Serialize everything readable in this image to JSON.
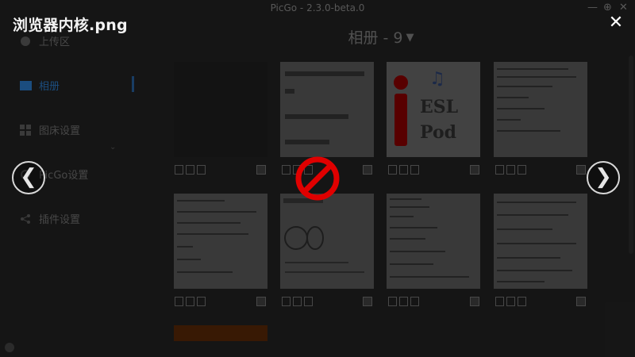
{
  "app": {
    "title": "PicGo - 2.3.0-beta.0",
    "window_controls": [
      "minimize-icon",
      "settings-icon",
      "close-icon"
    ]
  },
  "sidebar": {
    "items": [
      {
        "label": "上传区",
        "icon": "upload-icon"
      },
      {
        "label": "相册",
        "icon": "image-icon",
        "active": true
      },
      {
        "label": "图床设置",
        "icon": "grid-icon"
      },
      {
        "label": "PicGo设置",
        "icon": "gear-icon"
      },
      {
        "label": "插件设置",
        "icon": "share-icon"
      }
    ]
  },
  "gallery": {
    "title": "相册 - 9",
    "caret": "▼"
  },
  "thumbnail_text": {
    "esl_line1": "ESL",
    "esl_line2": "Pod"
  },
  "viewer": {
    "image_name": "浏览器内核.png",
    "close_glyph": "✕",
    "prev_glyph": "❮",
    "next_glyph": "❯",
    "cursor_icon": "not-allowed-icon"
  },
  "colors": {
    "active_accent": "#1c4f82",
    "upload_button": "#3a1a05",
    "not_allowed_red": "#e00000"
  }
}
